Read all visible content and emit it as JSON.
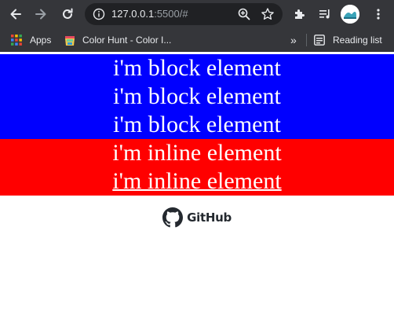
{
  "browser": {
    "url_host": "127.0.0.1",
    "url_rest": ":5500/#"
  },
  "bookmarks": {
    "apps_label": "Apps",
    "color_hunt_label": "Color Hunt - Color I...",
    "overflow_label": "»",
    "reading_list_label": "Reading list"
  },
  "content": {
    "block_lines": [
      "i'm block element",
      "i'm block element",
      "i'm block element"
    ],
    "inline_lines": [
      "i'm inline element",
      "i'm inline element"
    ],
    "github_label": "GitHub"
  },
  "colors": {
    "block_bg": "#0000ff",
    "inline_bg": "#ff0000",
    "chrome_bg": "#35363a"
  }
}
